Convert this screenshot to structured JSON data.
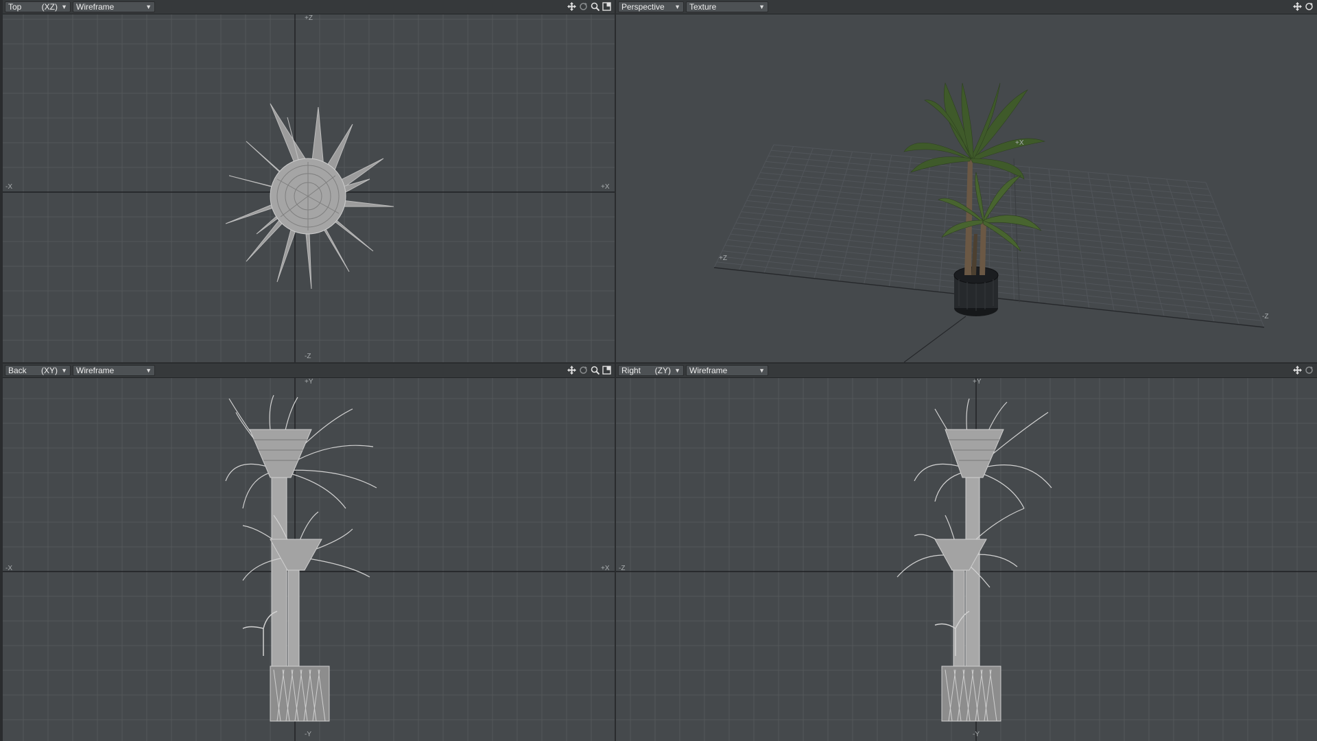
{
  "viewports": {
    "top": {
      "view": "Top",
      "projection": "(XZ)",
      "mode": "Wireframe",
      "axes": {
        "up": "+Z",
        "down": "-Z",
        "left": "-X",
        "right": "+X"
      }
    },
    "perspective": {
      "view": "Perspective",
      "mode": "Texture",
      "axes": {
        "x": "+X",
        "z_pos": "+Z",
        "z_neg": "-Z"
      }
    },
    "back": {
      "view": "Back",
      "projection": "(XY)",
      "mode": "Wireframe",
      "axes": {
        "up": "+Y",
        "down": "-Y",
        "left": "-X",
        "right": "+X"
      }
    },
    "right": {
      "view": "Right",
      "projection": "(ZY)",
      "mode": "Wireframe",
      "axes": {
        "up": "+Y",
        "down": "-Y",
        "left": "-Z"
      }
    }
  },
  "tool_icons": [
    "move-view-icon",
    "rotate-view-icon",
    "zoom-view-icon",
    "maximize-view-icon"
  ],
  "colors": {
    "viewport_bg": "#45494c",
    "grid": "#53575a",
    "axis": "#1f2123",
    "wire": "#b9b9b9",
    "header_bg": "#36393b",
    "leaf": "#3f5a2a",
    "trunk": "#5a4a38",
    "pot": "#1f2124"
  }
}
